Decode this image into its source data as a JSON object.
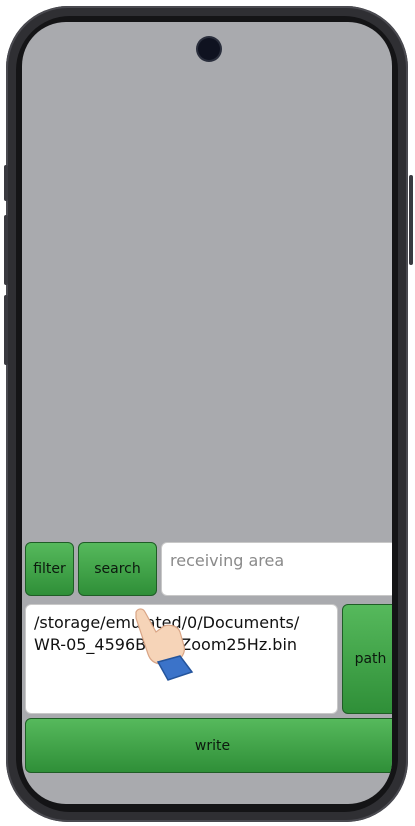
{
  "controls": {
    "filter_label": "filter",
    "search_label": "search",
    "receiving_placeholder": "receiving area",
    "file_path": "/storage/emulated/0/Documents/\nWR-05_4596B…3_Zoom25Hz.bin",
    "path_label": "path",
    "write_label": "write"
  },
  "colors": {
    "button_green": "#3fa348",
    "screen_gray": "#a9aaae"
  },
  "icons": {
    "pointer": "tap-hand-icon"
  }
}
